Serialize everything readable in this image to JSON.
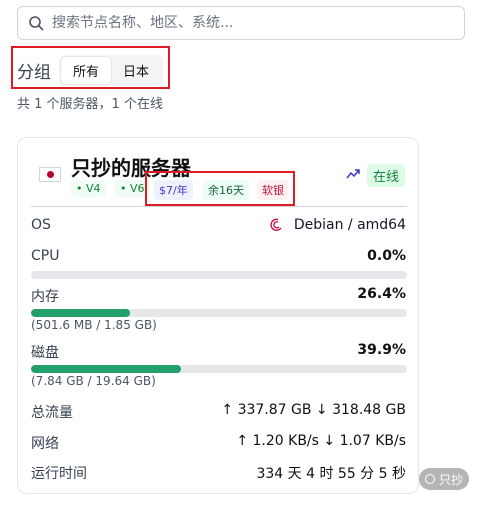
{
  "search": {
    "placeholder": "搜索节点名称、地区、系统...",
    "value": ""
  },
  "group": {
    "label": "分组",
    "options": [
      {
        "label": "所有",
        "active": true
      },
      {
        "label": "日本",
        "active": false
      }
    ]
  },
  "summary": "共 1 个服务器，1 个在线",
  "server": {
    "flag": "jp-flag-icon",
    "name": "只抄的服务器",
    "status": "在线",
    "tags": {
      "v4": "• V4",
      "v6": "• V6",
      "price": "$7/年",
      "remaining": "余16天",
      "type": "软银"
    },
    "os": {
      "label": "OS",
      "value": "Debian / amd64",
      "icon": "debian-icon"
    },
    "cpu": {
      "label": "CPU",
      "value": "0.0%",
      "percent": 0.0
    },
    "memory": {
      "label": "内存",
      "value": "26.4%",
      "percent": 26.4,
      "detail": "(501.6 MB / 1.85 GB)"
    },
    "disk": {
      "label": "磁盘",
      "value": "39.9%",
      "percent": 39.9,
      "detail": "(7.84 GB / 19.64 GB)"
    },
    "traffic": {
      "label": "总流量",
      "value": "↑ 337.87 GB ↓ 318.48 GB"
    },
    "network": {
      "label": "网络",
      "value": "↑ 1.20 KB/s ↓ 1.07 KB/s"
    },
    "uptime": {
      "label": "运行时间",
      "value": "334 天 4 时 55 分 5 秒"
    }
  },
  "watermark": "只抄",
  "colors": {
    "highlight": "#e01b24",
    "online": "#15803d",
    "bar_fill": "#22a06b"
  }
}
